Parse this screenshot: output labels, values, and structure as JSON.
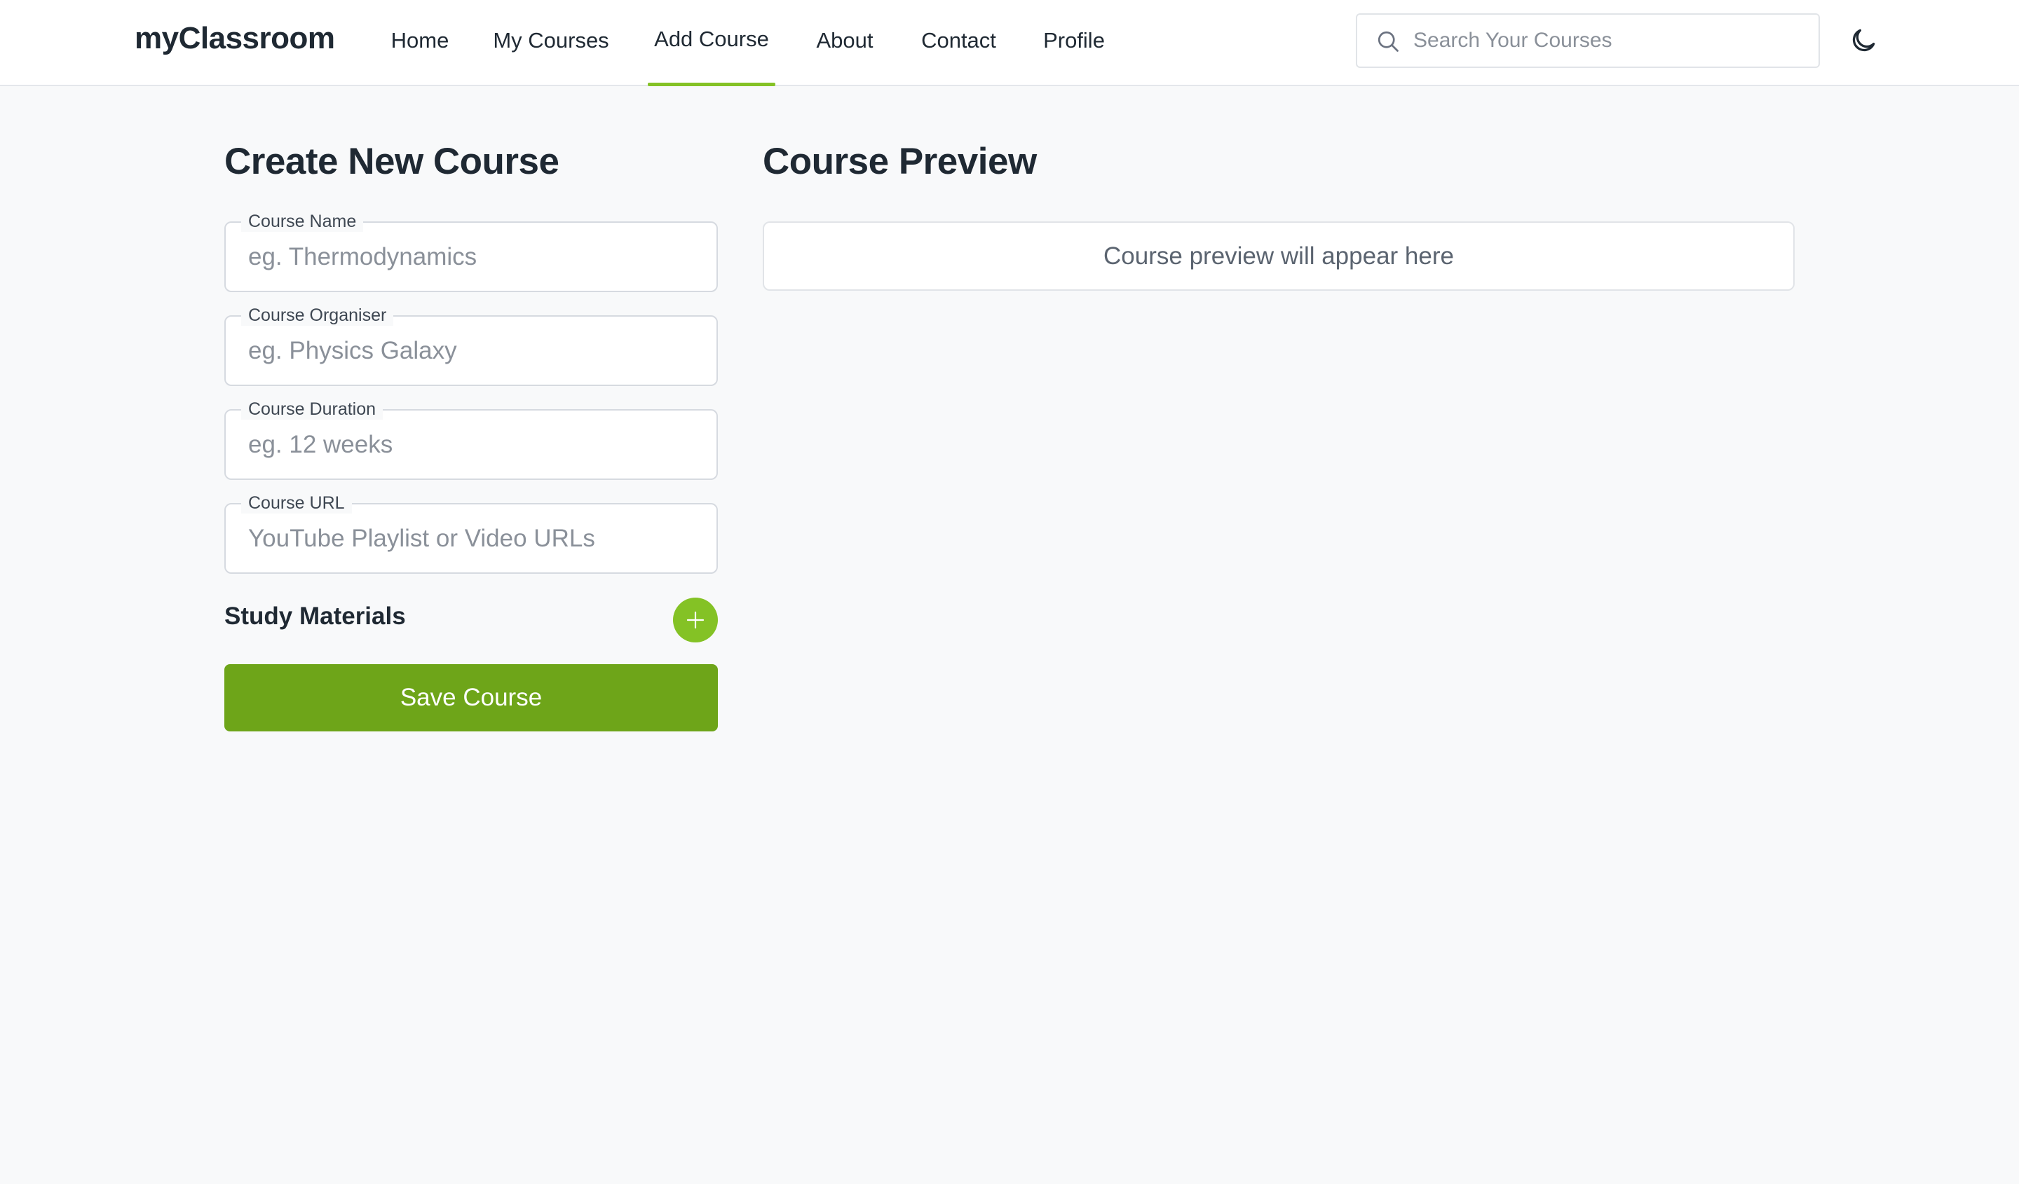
{
  "app": {
    "brand": "myClassroom"
  },
  "nav": {
    "items": [
      {
        "label": "Home"
      },
      {
        "label": "My Courses"
      },
      {
        "label": "Add Course",
        "active": true
      },
      {
        "label": "About"
      },
      {
        "label": "Contact"
      },
      {
        "label": "Profile"
      }
    ]
  },
  "search": {
    "placeholder": "Search Your Courses",
    "value": "",
    "icon": "search-icon"
  },
  "theme_toggle": {
    "icon": "moon-icon"
  },
  "form": {
    "title": "Create New Course",
    "fields": [
      {
        "label": "Course Name",
        "placeholder": "eg. Thermodynamics",
        "value": ""
      },
      {
        "label": "Course Organiser",
        "placeholder": "eg. Physics Galaxy",
        "value": ""
      },
      {
        "label": "Course Duration",
        "placeholder": "eg. 12 weeks",
        "value": ""
      },
      {
        "label": "Course URL",
        "placeholder": "YouTube Playlist or Video URLs",
        "value": ""
      }
    ],
    "materials_title": "Study Materials",
    "add_material_icon": "plus-icon",
    "save_label": "Save Course"
  },
  "preview": {
    "title": "Course Preview",
    "empty_text": "Course preview will appear here"
  },
  "colors": {
    "accent": "#84c225",
    "save_button": "#6ea519",
    "background": "#f8f9fa",
    "text": "#1f2933"
  }
}
